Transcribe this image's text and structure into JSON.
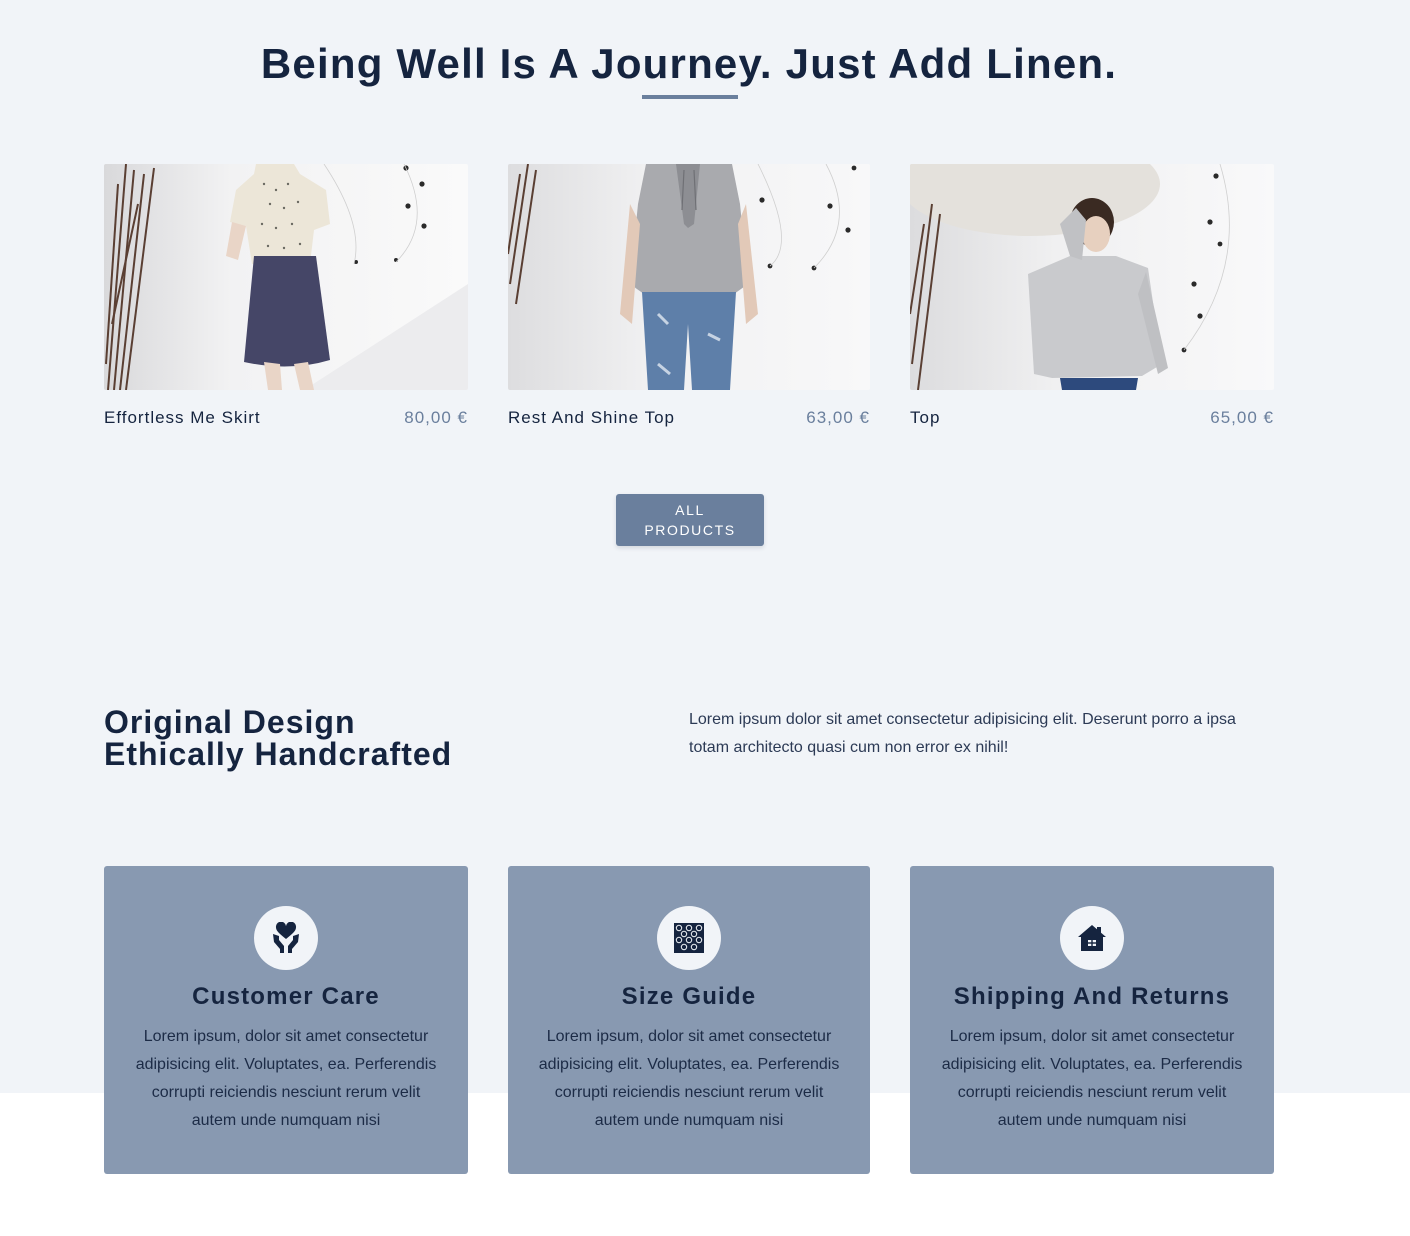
{
  "hero": {
    "title": "Being Well Is A Journey. Just Add Linen."
  },
  "products": [
    {
      "name": "Effortless Me Skirt",
      "price": "80,00 €"
    },
    {
      "name": "Rest And Shine Top",
      "price": "63,00 €"
    },
    {
      "name": "Top",
      "price": "65,00 €"
    }
  ],
  "all_products_button": {
    "label": "All Products"
  },
  "design": {
    "title_line1": "Original Design",
    "title_line2": "Ethically Handcrafted",
    "text": "Lorem ipsum dolor sit amet consectetur adipisicing elit. Deserunt porro a ipsa totam architecto quasi cum non error ex nihil!"
  },
  "features": [
    {
      "icon": "heart-hands-icon",
      "title": "Customer Care",
      "text": "Lorem ipsum, dolor sit amet consectetur adipisicing elit. Voluptates, ea. Perferendis corrupti reiciendis nesciunt rerum velit autem unde numquam nisi"
    },
    {
      "icon": "fabric-pattern-icon",
      "title": "Size Guide",
      "text": "Lorem ipsum, dolor sit amet consectetur adipisicing elit. Voluptates, ea. Perferendis corrupti reiciendis nesciunt rerum velit autem unde numquam nisi"
    },
    {
      "icon": "house-icon",
      "title": "Shipping And Returns",
      "text": "Lorem ipsum, dolor sit amet consectetur adipisicing elit. Voluptates, ea. Perferendis corrupti reiciendis nesciunt rerum velit autem unde numquam nisi"
    }
  ],
  "colors": {
    "navy": "#15243f",
    "accent": "#6a7f9d",
    "card_bg": "#8899b1",
    "section_bg": "#f1f4f8"
  }
}
